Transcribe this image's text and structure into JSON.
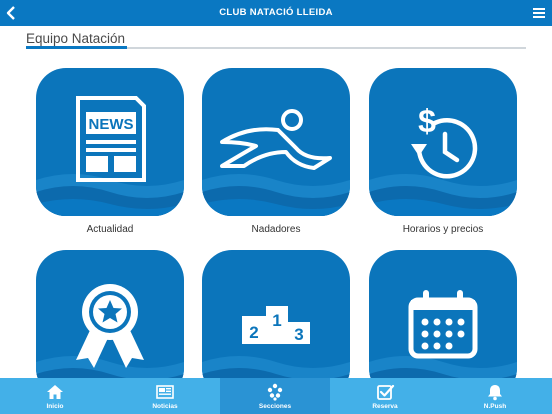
{
  "header": {
    "title": "CLUB NATACIÓ LLEIDA",
    "back_icon": "chevron-left-icon",
    "menu_icon": "hamburger-menu-icon"
  },
  "section": {
    "title": "Equipo Natación"
  },
  "tiles": [
    {
      "label": "Actualidad",
      "icon": "newspaper-icon",
      "badge_text": "NEWS"
    },
    {
      "label": "Nadadores",
      "icon": "swimmer-icon"
    },
    {
      "label": "Horarios y precios",
      "icon": "dollar-clock-icon",
      "symbol": "$"
    },
    {
      "label": "",
      "icon": "award-ribbon-icon"
    },
    {
      "label": "",
      "icon": "podium-icon",
      "podium": [
        "2",
        "1",
        "3"
      ]
    },
    {
      "label": "",
      "icon": "calendar-icon"
    }
  ],
  "tabbar": {
    "tabs": [
      {
        "label": "Inicio",
        "icon": "home-icon"
      },
      {
        "label": "Noticias",
        "icon": "newspaper-icon"
      },
      {
        "label": "Secciones",
        "icon": "sections-dots-icon",
        "active": true
      },
      {
        "label": "Reserva",
        "icon": "checkbox-icon"
      },
      {
        "label": "N.Push",
        "icon": "bell-icon"
      }
    ]
  },
  "colors": {
    "primary": "#0a78c2",
    "tile": "#0b75bb",
    "tabbar": "#43b0e8",
    "tab_active": "#2a93d4"
  }
}
